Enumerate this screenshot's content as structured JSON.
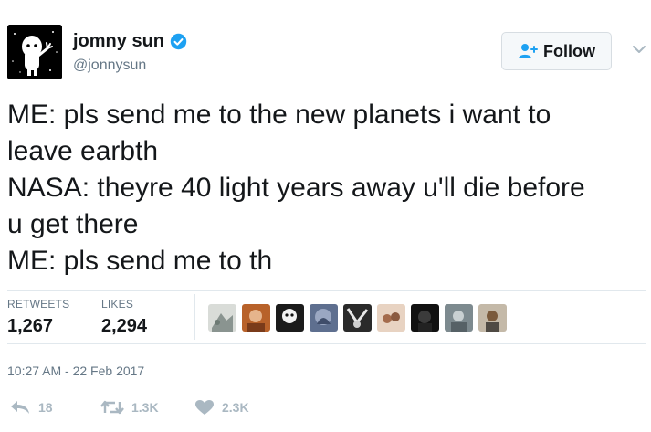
{
  "tweet": {
    "author": {
      "display_name": "jomny sun",
      "handle": "@jonnysun",
      "verified": true
    },
    "follow_button": {
      "label": "Follow",
      "icon": "add-user-icon"
    },
    "more_menu_icon": "chevron-down-icon",
    "text_lines": [
      "ME: pls send me to the new planets i want to",
      "leave earbth",
      "NASA: theyre 40 light years away u'll die before",
      "u get there",
      "ME: pls send me to th"
    ],
    "stats": {
      "retweets_label": "RETWEETS",
      "retweets_value": "1,267",
      "likes_label": "LIKES",
      "likes_value": "2,294"
    },
    "timestamp": "10:27 AM - 22 Feb 2017",
    "actions": {
      "reply_count": "18",
      "retweet_count": "1.3K",
      "like_count": "2.3K"
    }
  },
  "colors": {
    "text": "#14171a",
    "muted": "#657786",
    "action_gray": "#aab8c2",
    "verified_blue": "#1da1f2",
    "divider": "#e1e8ed"
  }
}
